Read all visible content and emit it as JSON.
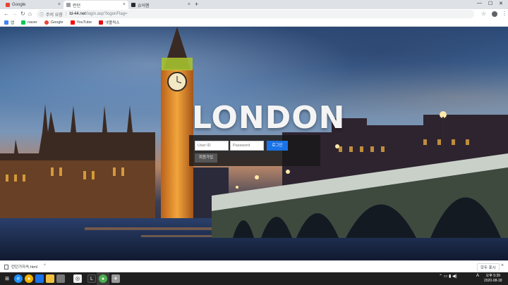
{
  "tabs": [
    {
      "title": "Google",
      "favicon": "google-g-icon",
      "active": false
    },
    {
      "title": "런던",
      "favicon": "page-icon",
      "active": true
    },
    {
      "title": "슈어헨",
      "favicon": "app-icon",
      "active": false
    }
  ],
  "toolbar": {
    "security_label": "주의 요함",
    "url_host": "ld-44.net",
    "url_path": "/login.asp?logonFlag="
  },
  "bookmarks": [
    {
      "label": "앱",
      "icon": "apps-grid-icon",
      "color": "#4285f4"
    },
    {
      "label": "naver",
      "icon": "naver-icon",
      "color": "#03c75a"
    },
    {
      "label": "Google",
      "icon": "google-g-icon",
      "color": "#ea4335"
    },
    {
      "label": "YouTube",
      "icon": "youtube-icon",
      "color": "#ff0000"
    },
    {
      "label": "넷플릭스",
      "icon": "netflix-icon",
      "color": "#e50914"
    }
  ],
  "hero": {
    "title": "LONDON"
  },
  "login": {
    "userid_placeholder": "User ID",
    "password_placeholder": "Password",
    "login_label": "로그인",
    "signup_label": "회원가입"
  },
  "download": {
    "filename": "런던가자속.html",
    "show_all": "모두 표시"
  },
  "taskbar": {
    "time": "오후 5:39",
    "date": "2020-08-18",
    "lang": "A"
  },
  "colors": {
    "accent": "#1a73e8",
    "login_panel": "#191919",
    "title": "#f4f4f4"
  }
}
